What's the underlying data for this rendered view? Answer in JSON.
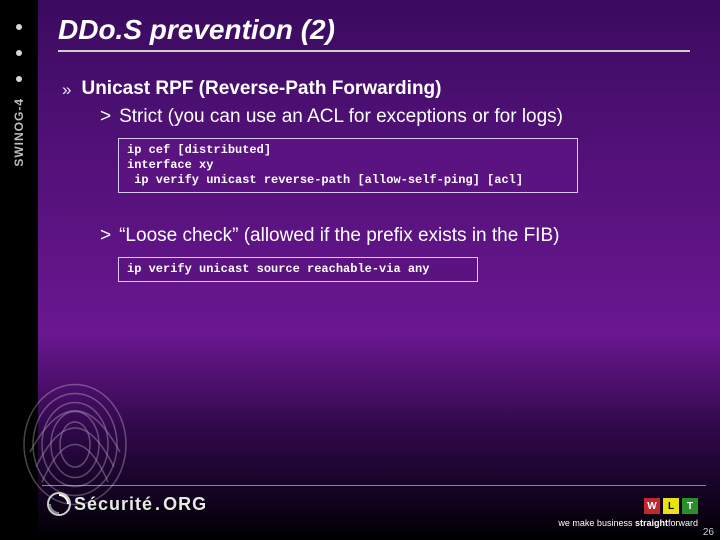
{
  "rail": {
    "label": "SWINOG-4"
  },
  "title": "DDo.S prevention (2)",
  "content": {
    "b1": {
      "marker": "»",
      "text": "Unicast RPF (Reverse-Path Forwarding)"
    },
    "s1": {
      "marker": ">",
      "text": "Strict (you can use an ACL for exceptions or for logs)"
    },
    "code1": "ip cef [distributed]\ninterface xy\n ip verify unicast reverse-path [allow-self-ping] [acl]",
    "s2": {
      "marker": ">",
      "text": "“Loose check” (allowed if the prefix exists in the FIB)"
    },
    "code2": "ip verify unicast source reachable-via any"
  },
  "footer": {
    "logo_text_a": "Sécurité",
    "logo_dot": ".",
    "logo_text_b": "ORG",
    "sq": {
      "w": "W",
      "l": "L",
      "t": "T"
    },
    "tagline_a": "we make business ",
    "tagline_b": "straight",
    "tagline_c": "forward",
    "page": "26"
  }
}
